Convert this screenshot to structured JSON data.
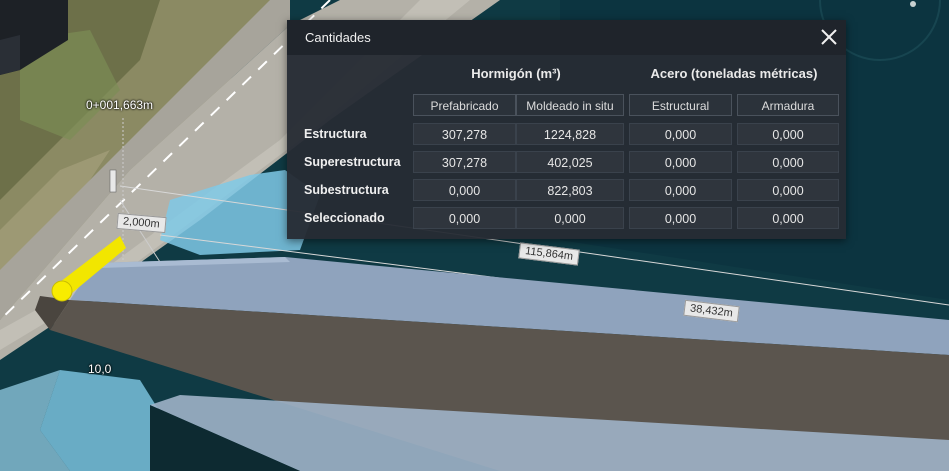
{
  "scene": {
    "station_label": "0+001,663m",
    "dimension_labels": [
      "2,000m",
      "115,864m",
      "38,432m"
    ],
    "elevation_label": "10,0"
  },
  "dialog": {
    "title": "Cantidades",
    "close_icon": "close-icon",
    "groups": [
      {
        "label": "Hormigón (m³)"
      },
      {
        "label": "Acero (toneladas métricas)"
      }
    ],
    "columns": [
      "Prefabricado",
      "Moldeado in situ",
      "Estructural",
      "Armadura"
    ],
    "rows": [
      {
        "label": "Estructura",
        "values": [
          "307,278",
          "1224,828",
          "0,000",
          "0,000"
        ]
      },
      {
        "label": "Superestructura",
        "values": [
          "307,278",
          "402,025",
          "0,000",
          "0,000"
        ]
      },
      {
        "label": "Subestructura",
        "values": [
          "0,000",
          "822,803",
          "0,000",
          "0,000"
        ]
      },
      {
        "label": "Seleccionado",
        "values": [
          "0,000",
          "0,000",
          "0,000",
          "0,000"
        ]
      }
    ]
  },
  "colors": {
    "dialog_bg": "#262c34",
    "header_bg": "#1f242b",
    "cell_bg": "#2f353d",
    "beam_top": "#8fa3bd",
    "pipe_yellow": "#f2e600",
    "water": "#0f3a44"
  }
}
